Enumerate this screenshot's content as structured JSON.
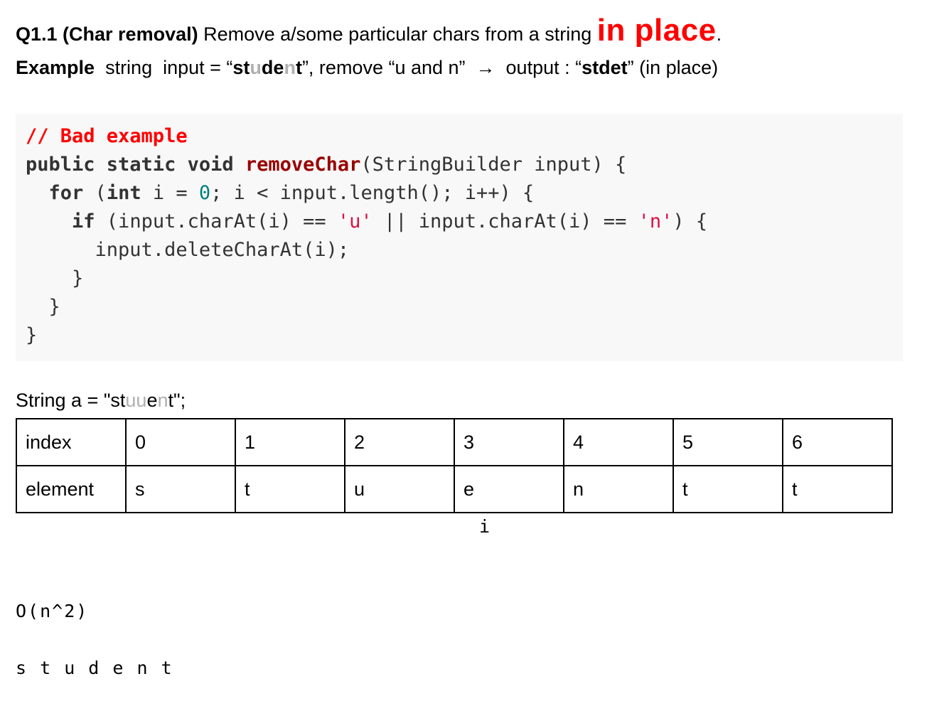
{
  "heading": {
    "label": "Q1.1 (Char removal)",
    "text": " Remove a/some particular chars from a string ",
    "emphasis": "in place",
    "end": "."
  },
  "example": {
    "label": "Example",
    "text_before": "  string  input = “",
    "word_parts": [
      "st",
      "u",
      "de",
      "n",
      "t"
    ],
    "text_middle": "”, remove “u and n”  →  output : “",
    "output_word": "stdet",
    "text_after": "” (in place)"
  },
  "code": {
    "comment": "// Bad example",
    "lines": [
      {
        "kw1": "public static void ",
        "fn": "removeChar",
        "rest": "(StringBuilder input) {"
      },
      {
        "indent": "  ",
        "kw1": "for",
        "p1": " (",
        "kw2": "int",
        "p2": " i = ",
        "num": "0",
        "p3": "; i < input.length(); i++) {"
      },
      {
        "indent": "    ",
        "kw1": "if",
        "p1": " (input.charAt(i) == ",
        "s1": "'u'",
        "p2": " || input.charAt(i) == ",
        "s2": "'n'",
        "p3": ") {"
      },
      {
        "text": "      input.deleteCharAt(i);"
      },
      {
        "text": "    }"
      },
      {
        "text": "  }"
      },
      {
        "text": "}"
      }
    ]
  },
  "string_a": {
    "prefix": "String a = \"st",
    "grey1": "uu",
    "mid": "e",
    "grey2": "n",
    "suffix": "t\";"
  },
  "table": {
    "rows": [
      [
        "index",
        "0",
        "1",
        "2",
        "3",
        "4",
        "5",
        "6"
      ],
      [
        "element",
        "s",
        "t",
        "u",
        "e",
        "n",
        "t",
        "t"
      ]
    ]
  },
  "pointer": "i",
  "complexity": "O(n^2)",
  "letters": "s t u d e n t"
}
